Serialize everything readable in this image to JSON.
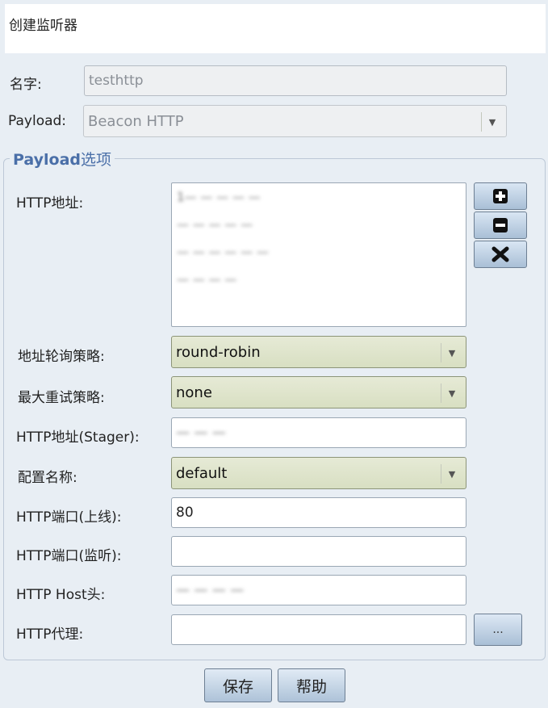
{
  "dialog": {
    "title": "创建监听器"
  },
  "form": {
    "name_label": "名字:",
    "name_value": "testhttp",
    "payload_label": "Payload:",
    "payload_value": "Beacon HTTP"
  },
  "options": {
    "group_title_bold": "Payload",
    "group_title_rest": "选项",
    "http_hosts_label": "HTTP地址:",
    "http_hosts": [
      "1— — — — —",
      "— — — — —",
      "— — — — — —",
      "— — — —"
    ],
    "rotation_label": "地址轮询策略:",
    "rotation_value": "round-robin",
    "retry_label": "最大重试策略:",
    "retry_value": "none",
    "stager_label": "HTTP地址(Stager):",
    "stager_value": "— — —",
    "profile_label": "配置名称:",
    "profile_value": "default",
    "port_bind_label": "HTTP端口(上线):",
    "port_bind_value": "80",
    "port_listen_label": "HTTP端口(监听):",
    "port_listen_value": "",
    "host_header_label": "HTTP Host头:",
    "host_header_value": "— — — —",
    "proxy_label": "HTTP代理:",
    "proxy_value": "",
    "proxy_button": "..."
  },
  "footer": {
    "save": "保存",
    "help": "帮助"
  },
  "icons": {
    "add": "plus-icon",
    "remove": "minus-icon",
    "clear": "x-icon",
    "dropdown": "chevron-down-icon"
  }
}
